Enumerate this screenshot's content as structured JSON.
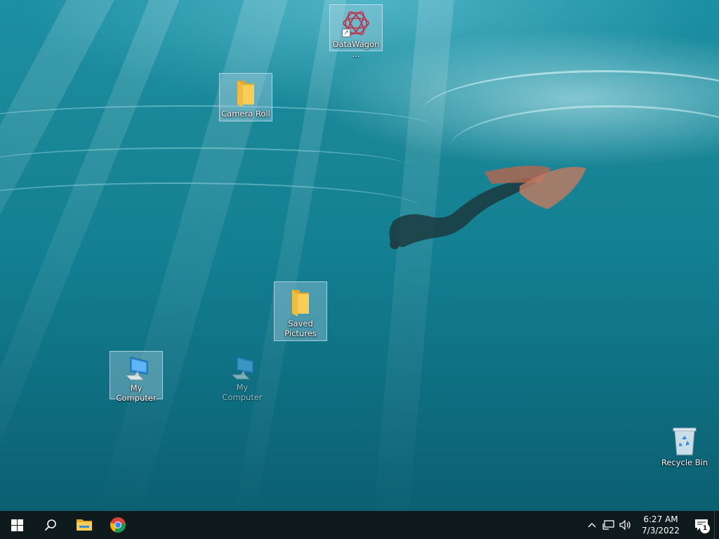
{
  "desktop": {
    "icons": [
      {
        "label": "DataWagon...",
        "type": "app-shortcut",
        "selected": true
      },
      {
        "label": "Camera Roll",
        "type": "folder",
        "selected": true
      },
      {
        "label": "Saved Pictures",
        "type": "folder",
        "selected": true
      },
      {
        "label": "My Computer",
        "type": "computer",
        "selected": true
      },
      {
        "label": "My Computer",
        "type": "computer",
        "selected": false,
        "ghost": true
      },
      {
        "label": "Recycle Bin",
        "type": "recycle-bin",
        "selected": false
      }
    ]
  },
  "taskbar": {
    "pinned": [
      {
        "name": "start",
        "icon": "windows-logo-icon"
      },
      {
        "name": "search",
        "icon": "search-icon"
      },
      {
        "name": "file-explorer",
        "icon": "folder-icon"
      },
      {
        "name": "chrome",
        "icon": "chrome-icon"
      }
    ],
    "tray": {
      "time": "6:27 AM",
      "date": "7/3/2022",
      "notification_count": "1"
    }
  },
  "colors": {
    "taskbar_bg": "#0f1a1c",
    "selection": "#aad2e6",
    "folder_yellow": "#f5c542"
  }
}
